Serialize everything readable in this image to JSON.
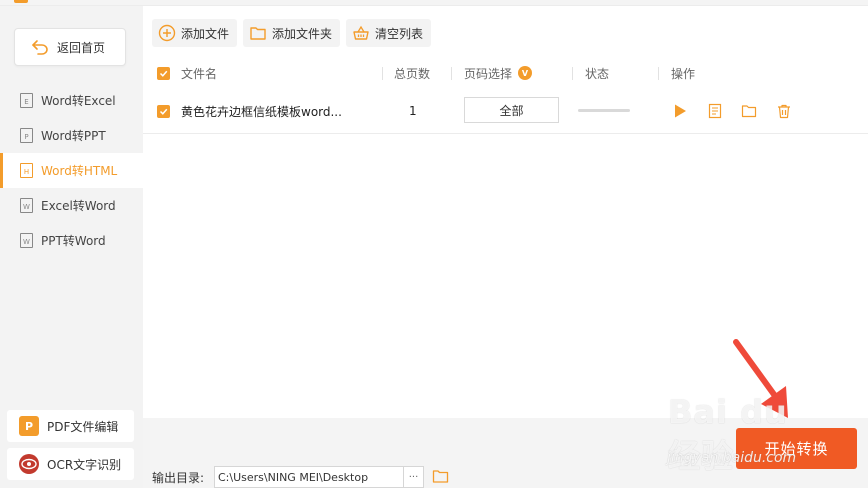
{
  "app": {
    "accent_color": "#f39c2b",
    "start_color": "#f05a24"
  },
  "sidebar": {
    "back_label": "返回首页",
    "items": [
      {
        "label": "Word转Excel",
        "icon": "E",
        "active": false
      },
      {
        "label": "Word转PPT",
        "icon": "P",
        "active": false
      },
      {
        "label": "Word转HTML",
        "icon": "H",
        "active": true
      },
      {
        "label": "Excel转Word",
        "icon": "W",
        "active": false
      },
      {
        "label": "PPT转Word",
        "icon": "W",
        "active": false
      }
    ],
    "tools": [
      {
        "label": "PDF文件编辑",
        "icon": "P"
      },
      {
        "label": "OCR文字识别",
        "icon": "ocr-eye-icon"
      }
    ]
  },
  "toolbar": {
    "add_file": "添加文件",
    "add_folder": "添加文件夹",
    "clear_list": "清空列表"
  },
  "table": {
    "headers": {
      "filename": "文件名",
      "pages": "总页数",
      "page_select": "页码选择",
      "page_select_badge": "V",
      "status": "状态",
      "actions": "操作"
    },
    "rows": [
      {
        "filename": "黄色花卉边框信纸模板word...",
        "pages": "1",
        "page_select": "全部",
        "progress": 0,
        "checked": true
      }
    ]
  },
  "bottom": {
    "output_label": "输出目录:",
    "output_path": "C:\\Users\\NING MEI\\Desktop",
    "more": "···",
    "start_label": "开始转换"
  },
  "watermark": {
    "logo": "Bai du 经验",
    "sub": "jingyan.baidu.com"
  }
}
